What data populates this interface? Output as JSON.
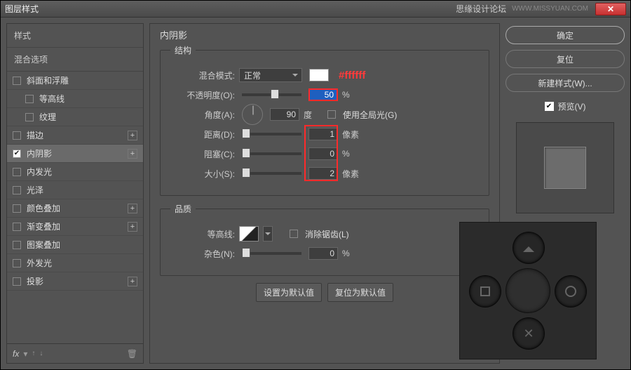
{
  "window": {
    "title": "图层样式",
    "forum": "思缘设计论坛",
    "site": "WWW.MISSYUAN.COM"
  },
  "left": {
    "hdr_styles": "样式",
    "hdr_blend": "混合选项",
    "items": [
      {
        "label": "斜面和浮雕",
        "checked": false,
        "plus": false,
        "indent": false
      },
      {
        "label": "等高线",
        "checked": false,
        "plus": false,
        "indent": true
      },
      {
        "label": "纹理",
        "checked": false,
        "plus": false,
        "indent": true
      },
      {
        "label": "描边",
        "checked": false,
        "plus": true,
        "indent": false
      },
      {
        "label": "内阴影",
        "checked": true,
        "plus": true,
        "indent": false,
        "selected": true
      },
      {
        "label": "内发光",
        "checked": false,
        "plus": false,
        "indent": false
      },
      {
        "label": "光泽",
        "checked": false,
        "plus": false,
        "indent": false
      },
      {
        "label": "颜色叠加",
        "checked": false,
        "plus": true,
        "indent": false
      },
      {
        "label": "渐变叠加",
        "checked": false,
        "plus": true,
        "indent": false
      },
      {
        "label": "图案叠加",
        "checked": false,
        "plus": false,
        "indent": false
      },
      {
        "label": "外发光",
        "checked": false,
        "plus": false,
        "indent": false
      },
      {
        "label": "投影",
        "checked": false,
        "plus": true,
        "indent": false
      }
    ],
    "fx": "fx"
  },
  "mid": {
    "title": "内阴影",
    "structure": "结构",
    "blend_label": "混合模式:",
    "blend_value": "正常",
    "anno": "#ffffff",
    "opacity_label": "不透明度(O):",
    "opacity_value": "50",
    "pct": "%",
    "angle_label": "角度(A):",
    "angle_value": "90",
    "deg": "度",
    "global": "使用全局光(G)",
    "dist_label": "距离(D):",
    "dist_value": "1",
    "px": "像素",
    "choke_label": "阻塞(C):",
    "choke_value": "0",
    "size_label": "大小(S):",
    "size_value": "2",
    "quality": "品质",
    "contour_label": "等高线:",
    "aa": "消除锯齿(L)",
    "noise_label": "杂色(N):",
    "noise_value": "0",
    "btn_default": "设置为默认值",
    "btn_reset": "复位为默认值"
  },
  "right": {
    "ok": "确定",
    "cancel": "复位",
    "newstyle": "新建样式(W)...",
    "preview": "预览(V)"
  },
  "chart_data": {
    "type": "table",
    "title": "内阴影 — 结构",
    "rows": [
      {
        "param": "混合模式",
        "value": "正常",
        "color": "#ffffff"
      },
      {
        "param": "不透明度",
        "value": 50,
        "unit": "%"
      },
      {
        "param": "角度",
        "value": 90,
        "unit": "度",
        "global_light": false
      },
      {
        "param": "距离",
        "value": 1,
        "unit": "像素"
      },
      {
        "param": "阻塞",
        "value": 0,
        "unit": "%"
      },
      {
        "param": "大小",
        "value": 2,
        "unit": "像素"
      },
      {
        "param": "杂色",
        "value": 0,
        "unit": "%"
      }
    ]
  }
}
